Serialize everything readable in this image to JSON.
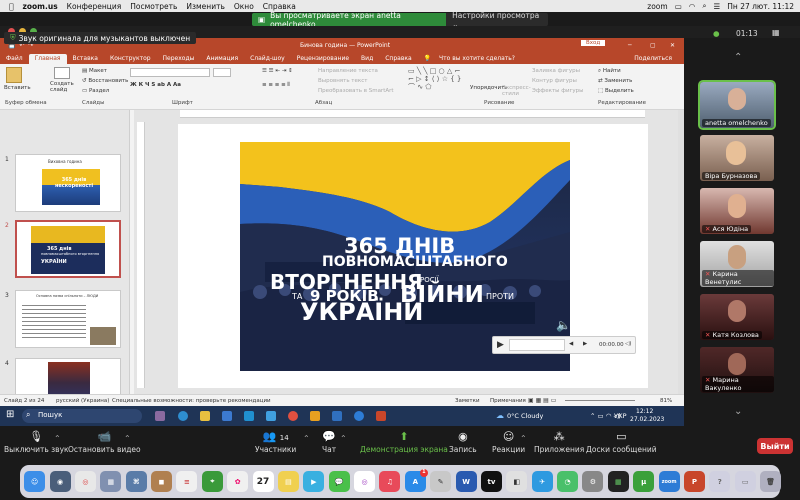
{
  "mac_menu": {
    "app": "zoom.us",
    "items": [
      "Конференция",
      "Посмотреть",
      "Изменить",
      "Окно",
      "Справка"
    ],
    "clock": "Пн 27 лют.  11:12"
  },
  "share_banner": {
    "text": "Вы просматриваете экран anetta omelchenko",
    "options": "Настройки просмотра"
  },
  "zoom_header": {
    "app_name": "zoom",
    "timer": "01:13"
  },
  "notice": "Звук оригинала для музыкантов выключен",
  "ppt": {
    "title": "Бинова година  —  PowerPoint",
    "title_right": "Вход",
    "tabs": [
      "Файл",
      "Главная",
      "Вставка",
      "Конструктор",
      "Переходы",
      "Анимация",
      "Слайд-шоу",
      "Рецензирование",
      "Вид",
      "Справка",
      "Что вы хотите сделать?"
    ],
    "share": "Поделиться",
    "ribbon": {
      "paste": "Вставить",
      "create_slide": "Создать слайд",
      "clipboard": "Буфер обмена",
      "slides": "Слайды",
      "font": "Шрифт",
      "paragraph": "Абзац",
      "drawing": "Рисование",
      "editing": "Редактирование",
      "layout": "Макет",
      "restore": "Восстановить",
      "section": "Раздел",
      "text_dir": "Направление текста",
      "align_text": "Выровнять текст",
      "smartart": "Преобразовать в SmartArt",
      "arrange": "Упорядочить",
      "quick_styles": "Экспресс-стили",
      "fill": "Заливка фигуры",
      "outline": "Контур фигуры",
      "effects": "Эффекты фигуры",
      "find": "Найти",
      "replace": "Заменить",
      "select": "Выделить"
    },
    "thumbnails": [
      {
        "num": "1",
        "title": "Виховна година",
        "line": "365 днів нескореності"
      },
      {
        "num": "2",
        "line1": "365 днів",
        "line2": "повномасштабного вторгнення",
        "line3": "УКРАЇНИ"
      },
      {
        "num": "3",
        "title": "Основна назва спільноти – ЛЮДИ"
      },
      {
        "num": "4",
        "title": ""
      },
      {
        "num": "5",
        "title": ""
      }
    ],
    "slide": {
      "l1": "365 ДНІВ",
      "l2": "ПОВНОМАСШТАБНОГО",
      "l3": "ВТОРГНЕННЯ",
      "l3b": "РОСІЇ",
      "l4a": "ТА",
      "l4b": "9 РОКІВ",
      "l4c": "ВІЙНИ",
      "l4d": "ПРОТИ",
      "l5": "УКРАЇНИ"
    },
    "audio": {
      "time": "00:00.00"
    },
    "status": {
      "slide": "Слайд 2 из 24",
      "lang": "русский (Украина)",
      "access": "Специальные возможности: проверьте рекомендации",
      "notes": "Заметки",
      "comments": "Примечания",
      "zoom": "81%"
    }
  },
  "taskbar": {
    "search": "Пошук",
    "weather": "0°C  Cloudy",
    "lang": "УКР",
    "time": "12:12",
    "date": "27.02.2023"
  },
  "participants": [
    {
      "name": "anetta omelchenko",
      "color": "#8fa8c0"
    },
    {
      "name": "Віра Бурназова",
      "color": "#c9a48a"
    },
    {
      "name": "Ася Юдіна",
      "color": "#a06050"
    },
    {
      "name": "Карина Венетулис",
      "color": "#c8c0c0"
    },
    {
      "name": "Катя Козлова",
      "color": "#7a4545"
    },
    {
      "name": "Марина Вакуленко",
      "color": "#553030"
    }
  ],
  "controls": {
    "mute": "Выключить звук",
    "video": "Остановить видео",
    "participants": "Участники",
    "participants_count": "14",
    "chat": "Чат",
    "share": "Демонстрация экрана",
    "record": "Запись",
    "reactions": "Реакции",
    "apps": "Приложения",
    "whiteboard": "Доски сообщений",
    "leave": "Выйти"
  },
  "dock": {
    "calendar_day": "27",
    "appstore_badge": "1"
  },
  "colors": {
    "ppt_accent": "#b7472a",
    "zoom_green": "#2e8b3a",
    "leave_red": "#cc3333",
    "speaker_outline": "#6ac04a"
  }
}
